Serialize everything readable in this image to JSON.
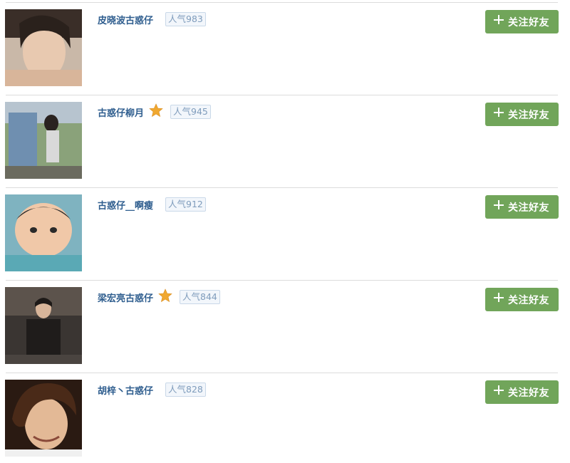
{
  "users": [
    {
      "name": "皮晓波古惑仔",
      "popularity": "人气983",
      "starred": false,
      "follow_label": "关注好友"
    },
    {
      "name": "古惑仔柳月",
      "popularity": "人气945",
      "starred": true,
      "follow_label": "关注好友"
    },
    {
      "name": "古惑仔__啊瘦",
      "popularity": "人气912",
      "starred": false,
      "follow_label": "关注好友"
    },
    {
      "name": "梁宏亮古惑仔",
      "popularity": "人气844",
      "starred": true,
      "follow_label": "关注好友"
    },
    {
      "name": "胡梓丶古惑仔",
      "popularity": "人气828",
      "starred": false,
      "follow_label": "关注好友"
    }
  ],
  "colors": {
    "name_link": "#2e5d8e",
    "follow_button": "#71a55a",
    "star": "#f0a830"
  },
  "icons": {
    "star": "star-icon",
    "plus": "plus-icon"
  }
}
